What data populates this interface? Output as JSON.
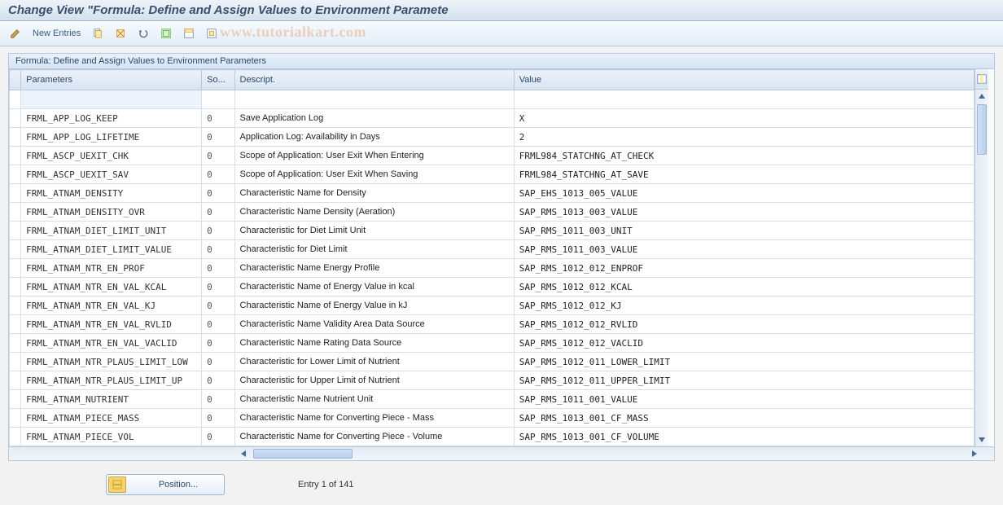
{
  "title": "Change View \"Formula: Define and Assign Values to Environment Paramete",
  "watermark": "www.tutorialkart.com",
  "toolbar": {
    "new_entries": "New Entries"
  },
  "panel_header": "Formula: Define and Assign Values to Environment Parameters",
  "columns": {
    "parameters": "Parameters",
    "sort": "So...",
    "descript": "Descript.",
    "value": "Value"
  },
  "rows": [
    {
      "param": "",
      "sort": "",
      "desc": "",
      "val": ""
    },
    {
      "param": "FRML_APP_LOG_KEEP",
      "sort": "0",
      "desc": "Save Application Log",
      "val": "X"
    },
    {
      "param": "FRML_APP_LOG_LIFETIME",
      "sort": "0",
      "desc": "Application Log: Availability in Days",
      "val": "2"
    },
    {
      "param": "FRML_ASCP_UEXIT_CHK",
      "sort": "0",
      "desc": "Scope of Application: User Exit When Entering",
      "val": "FRML984_STATCHNG_AT_CHECK"
    },
    {
      "param": "FRML_ASCP_UEXIT_SAV",
      "sort": "0",
      "desc": "Scope of Application: User Exit When Saving",
      "val": "FRML984_STATCHNG_AT_SAVE"
    },
    {
      "param": "FRML_ATNAM_DENSITY",
      "sort": "0",
      "desc": "Characteristic Name for Density",
      "val": "SAP_EHS_1013_005_VALUE"
    },
    {
      "param": "FRML_ATNAM_DENSITY_OVR",
      "sort": "0",
      "desc": "Characteristic Name Density (Aeration)",
      "val": "SAP_RMS_1013_003_VALUE"
    },
    {
      "param": "FRML_ATNAM_DIET_LIMIT_UNIT",
      "sort": "0",
      "desc": "Characteristic for Diet Limit Unit",
      "val": "SAP_RMS_1011_003_UNIT"
    },
    {
      "param": "FRML_ATNAM_DIET_LIMIT_VALUE",
      "sort": "0",
      "desc": "Characteristic for Diet Limit",
      "val": "SAP_RMS_1011_003_VALUE"
    },
    {
      "param": "FRML_ATNAM_NTR_EN_PROF",
      "sort": "0",
      "desc": "Characteristic Name Energy Profile",
      "val": "SAP_RMS_1012_012_ENPROF"
    },
    {
      "param": "FRML_ATNAM_NTR_EN_VAL_KCAL",
      "sort": "0",
      "desc": "Characteristic Name of Energy Value in kcal",
      "val": "SAP_RMS_1012_012_KCAL"
    },
    {
      "param": "FRML_ATNAM_NTR_EN_VAL_KJ",
      "sort": "0",
      "desc": "Characteristic Name of Energy Value in kJ",
      "val": "SAP_RMS_1012_012_KJ"
    },
    {
      "param": "FRML_ATNAM_NTR_EN_VAL_RVLID",
      "sort": "0",
      "desc": "Characteristic Name Validity Area Data Source",
      "val": "SAP_RMS_1012_012_RVLID"
    },
    {
      "param": "FRML_ATNAM_NTR_EN_VAL_VACLID",
      "sort": "0",
      "desc": "Characteristic Name Rating Data Source",
      "val": "SAP_RMS_1012_012_VACLID"
    },
    {
      "param": "FRML_ATNAM_NTR_PLAUS_LIMIT_LOW",
      "sort": "0",
      "desc": "Characteristic for Lower Limit of Nutrient",
      "val": "SAP_RMS_1012_011_LOWER_LIMIT"
    },
    {
      "param": "FRML_ATNAM_NTR_PLAUS_LIMIT_UP",
      "sort": "0",
      "desc": "Characteristic for Upper Limit of Nutrient",
      "val": "SAP_RMS_1012_011_UPPER_LIMIT"
    },
    {
      "param": "FRML_ATNAM_NUTRIENT",
      "sort": "0",
      "desc": "Characteristic Name Nutrient Unit",
      "val": "SAP_RMS_1011_001_VALUE"
    },
    {
      "param": "FRML_ATNAM_PIECE_MASS",
      "sort": "0",
      "desc": "Characteristic Name for Converting Piece - Mass",
      "val": "SAP_RMS_1013_001_CF_MASS"
    },
    {
      "param": "FRML_ATNAM_PIECE_VOL",
      "sort": "0",
      "desc": "Characteristic Name for Converting Piece - Volume",
      "val": "SAP_RMS_1013_001_CF_VOLUME"
    }
  ],
  "footer": {
    "position": "Position...",
    "entry": "Entry 1 of 141"
  }
}
